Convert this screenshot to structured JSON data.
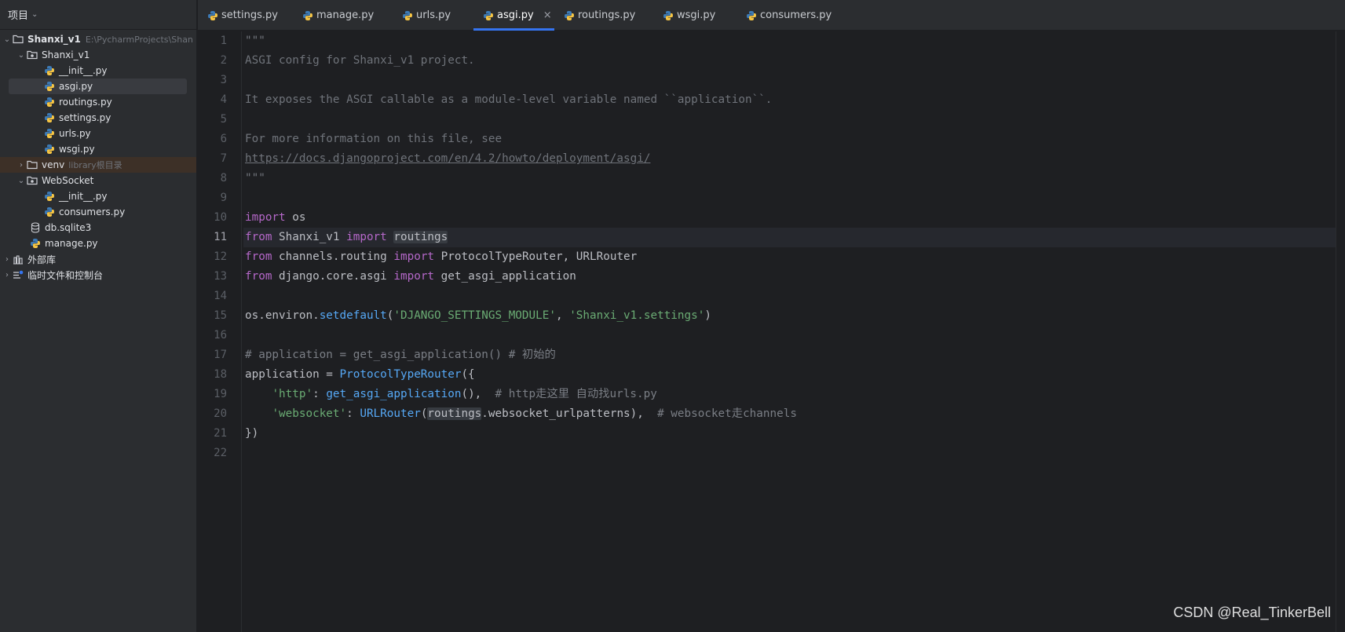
{
  "sidebar": {
    "title": "项目",
    "tree": [
      {
        "label": "Shanxi_v1",
        "hint": "E:\\PycharmProjects\\Shan",
        "type": "folder",
        "bold": true
      },
      {
        "label": "Shanxi_v1",
        "type": "package"
      },
      {
        "label": "__init__.py",
        "type": "py"
      },
      {
        "label": "asgi.py",
        "type": "py"
      },
      {
        "label": "routings.py",
        "type": "py"
      },
      {
        "label": "settings.py",
        "type": "py"
      },
      {
        "label": "urls.py",
        "type": "py"
      },
      {
        "label": "wsgi.py",
        "type": "py"
      },
      {
        "label": "venv",
        "hint": "library根目录",
        "type": "folder"
      },
      {
        "label": "WebSocket",
        "type": "package"
      },
      {
        "label": "__init__.py",
        "type": "py"
      },
      {
        "label": "consumers.py",
        "type": "py"
      },
      {
        "label": "db.sqlite3",
        "type": "db"
      },
      {
        "label": "manage.py",
        "type": "py"
      },
      {
        "label": "外部库",
        "type": "library"
      },
      {
        "label": "临时文件和控制台",
        "type": "scratch"
      }
    ]
  },
  "tabs": [
    {
      "label": "settings.py"
    },
    {
      "label": "manage.py"
    },
    {
      "label": "urls.py"
    },
    {
      "label": "asgi.py",
      "active": true,
      "close": "×"
    },
    {
      "label": "routings.py"
    },
    {
      "label": "wsgi.py"
    },
    {
      "label": "consumers.py"
    }
  ],
  "editor": {
    "current_line": 11,
    "line_numbers": [
      "1",
      "2",
      "3",
      "4",
      "5",
      "6",
      "7",
      "8",
      "9",
      "10",
      "11",
      "12",
      "13",
      "14",
      "15",
      "16",
      "17",
      "18",
      "19",
      "20",
      "21",
      "22"
    ],
    "code": {
      "l1": "\"\"\"",
      "l2": "ASGI config for Shanxi_v1 project.",
      "l4": "It exposes the ASGI callable as a module-level variable named ``application``.",
      "l6": "For more information on this file, see",
      "l7": "https://docs.djangoproject.com/en/4.2/howto/deployment/asgi/",
      "l8": "\"\"\"",
      "kw_import": "import",
      "kw_from": "from",
      "os": "os",
      "shanxi": "Shanxi_v1",
      "routings": "routings",
      "channels_routing": "channels.routing",
      "ptr_urlrouter": "ProtocolTypeRouter, URLRouter",
      "django_core_asgi": "django.core.asgi",
      "get_asgi_application": "get_asgi_application",
      "os_environ": "os.environ.",
      "setdefault": "setdefault",
      "paren_open": "(",
      "str_settings_module": "'DJANGO_SETTINGS_MODULE'",
      "comma": ", ",
      "str_settings_val": "'Shanxi_v1.settings'",
      "paren_close": ")",
      "l17": "# application = get_asgi_application() # 初始的",
      "application_eq": "application = ",
      "ProtocolTypeRouter": "ProtocolTypeRouter",
      "brace_open": "({",
      "indent": "    ",
      "str_http": "'http'",
      "colon": ": ",
      "call_end": "(),  ",
      "cm_http": "# http走这里 自动找urls.py",
      "str_websocket": "'websocket'",
      "URLRouter": "URLRouter",
      "ws_attr": ".websocket_urlpatterns),  ",
      "cm_ws": "# websocket走channels",
      "brace_close": "})"
    }
  },
  "watermark": "CSDN @Real_TinkerBell",
  "colors": {
    "keyword": "#cf8e6d",
    "import_keyword": "#b568c9",
    "function": "#56a8f5",
    "string": "#6aab73",
    "comment": "#7a7e85",
    "accent": "#3574f0"
  }
}
